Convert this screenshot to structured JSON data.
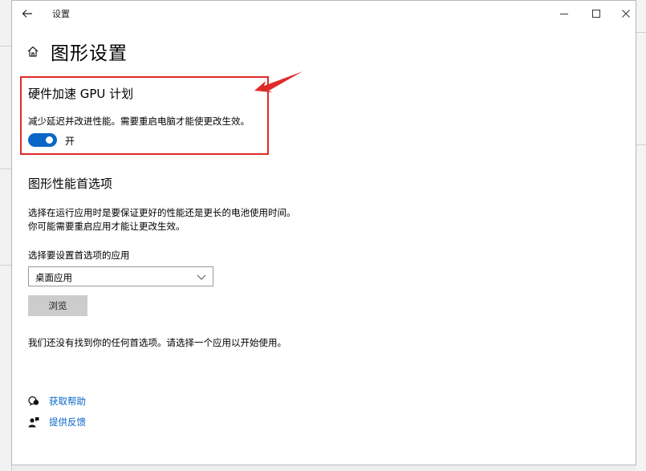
{
  "window": {
    "title": "设置",
    "controls": {
      "minimize": "minimize-icon",
      "maximize": "maximize-icon",
      "close": "close-icon"
    }
  },
  "page": {
    "title": "图形设置"
  },
  "gpu_scheduling": {
    "title": "硬件加速 GPU 计划",
    "description": "减少延迟并改进性能。需要重启电脑才能使更改生效。",
    "toggle_state": "开",
    "toggle_on": true
  },
  "graphics_preference": {
    "title": "图形性能首选项",
    "description_line1": "选择在运行应用时是要保证更好的性能还是更长的电池使用时间。",
    "description_line2": "你可能需要重启应用才能让更改生效。",
    "choose_label": "选择要设置首选项的应用",
    "selected_app_type": "桌面应用",
    "browse_label": "浏览",
    "empty_message": "我们还没有找到你的任何首选项。请选择一个应用以开始使用。"
  },
  "help": {
    "get_help": "获取帮助",
    "feedback": "提供反馈"
  },
  "colors": {
    "accent": "#0a67c7",
    "highlight": "#e02a2a",
    "button_bg": "#cccccc"
  }
}
